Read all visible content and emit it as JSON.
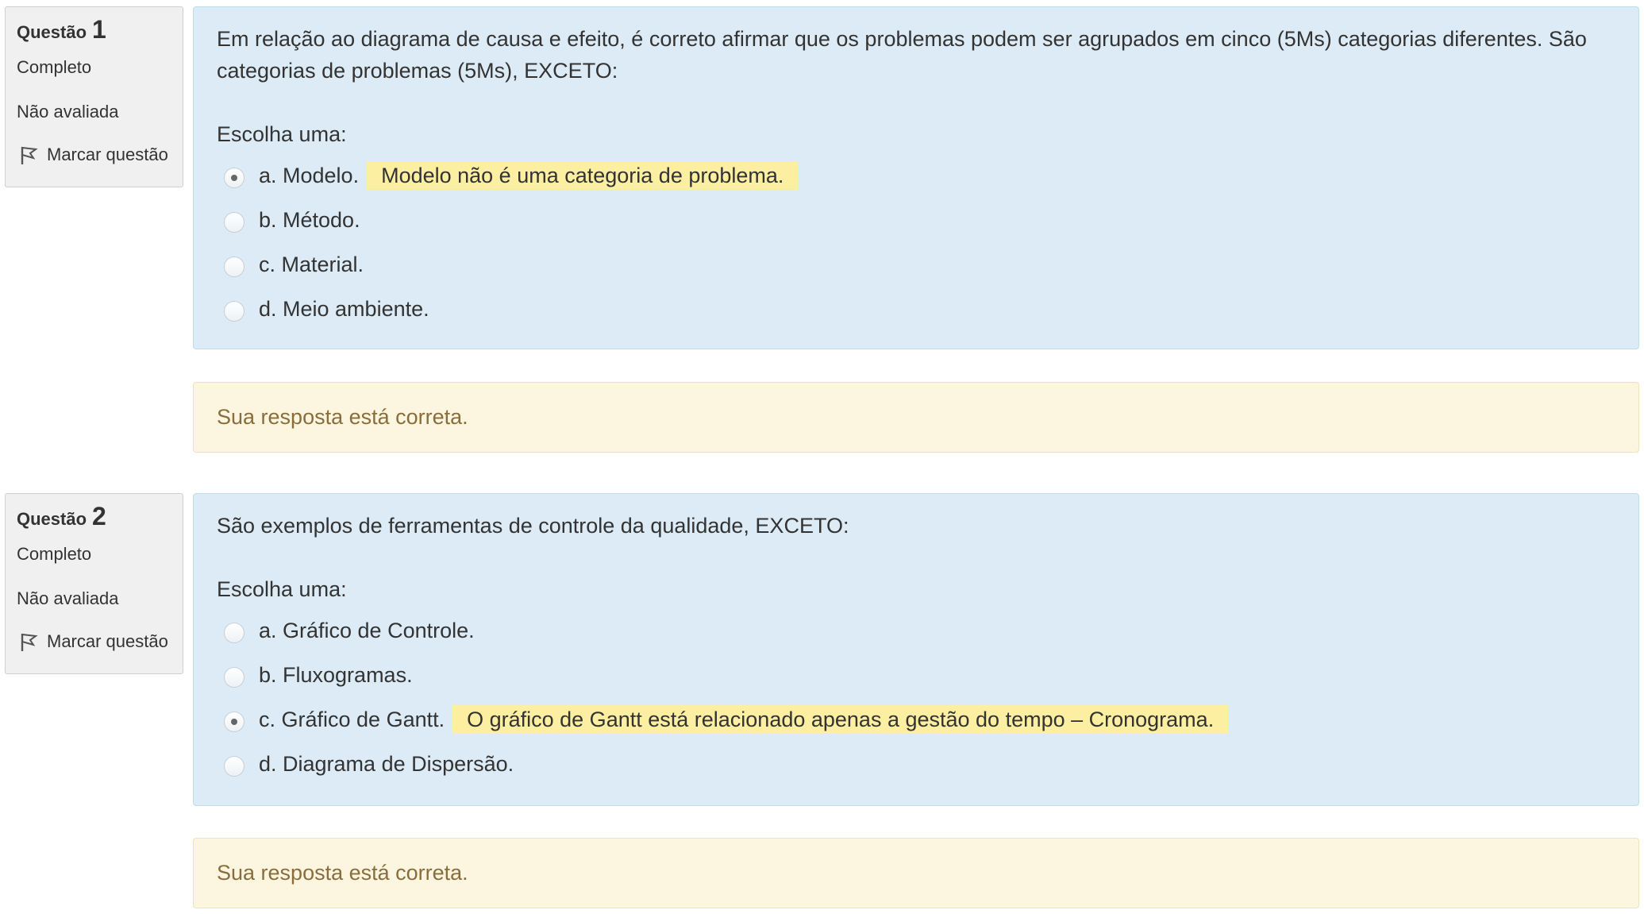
{
  "questions": [
    {
      "label": "Questão",
      "number": "1",
      "state": "Completo",
      "grade": "Não avaliada",
      "flag_label": "Marcar questão",
      "text": "Em relação ao diagrama de causa e efeito, é correto afirmar que os problemas podem ser agrupados em cinco (5Ms) categorias diferentes. São categorias de problemas (5Ms), EXCETO:",
      "prompt": "Escolha uma:",
      "options": [
        {
          "label": "a. Modelo.",
          "checked": true,
          "feedback": "Modelo não é uma categoria de problema."
        },
        {
          "label": "b. Método.",
          "checked": false
        },
        {
          "label": "c. Material.",
          "checked": false
        },
        {
          "label": "d. Meio ambiente.",
          "checked": false
        }
      ],
      "outcome": "Sua resposta está correta."
    },
    {
      "label": "Questão",
      "number": "2",
      "state": "Completo",
      "grade": "Não avaliada",
      "flag_label": "Marcar questão",
      "text": "São exemplos de ferramentas de controle da qualidade, EXCETO:",
      "prompt": "Escolha uma:",
      "options": [
        {
          "label": "a. Gráfico de Controle.",
          "checked": false
        },
        {
          "label": "b. Fluxogramas.",
          "checked": false
        },
        {
          "label": "c. Gráfico de Gantt.",
          "checked": true,
          "feedback": "O gráfico de Gantt está relacionado apenas a gestão do tempo – Cronograma."
        },
        {
          "label": "d. Diagrama de Dispersão.",
          "checked": false
        }
      ],
      "outcome": "Sua resposta está correta."
    }
  ],
  "colors": {
    "formulation_bg": "#dcebf5",
    "outcome_bg": "#fcf6e1",
    "outcome_text": "#8a6d3b",
    "highlight": "#fcefa1",
    "info_bg": "#f0f0f0"
  },
  "icons": {
    "flag": "flag-icon"
  }
}
